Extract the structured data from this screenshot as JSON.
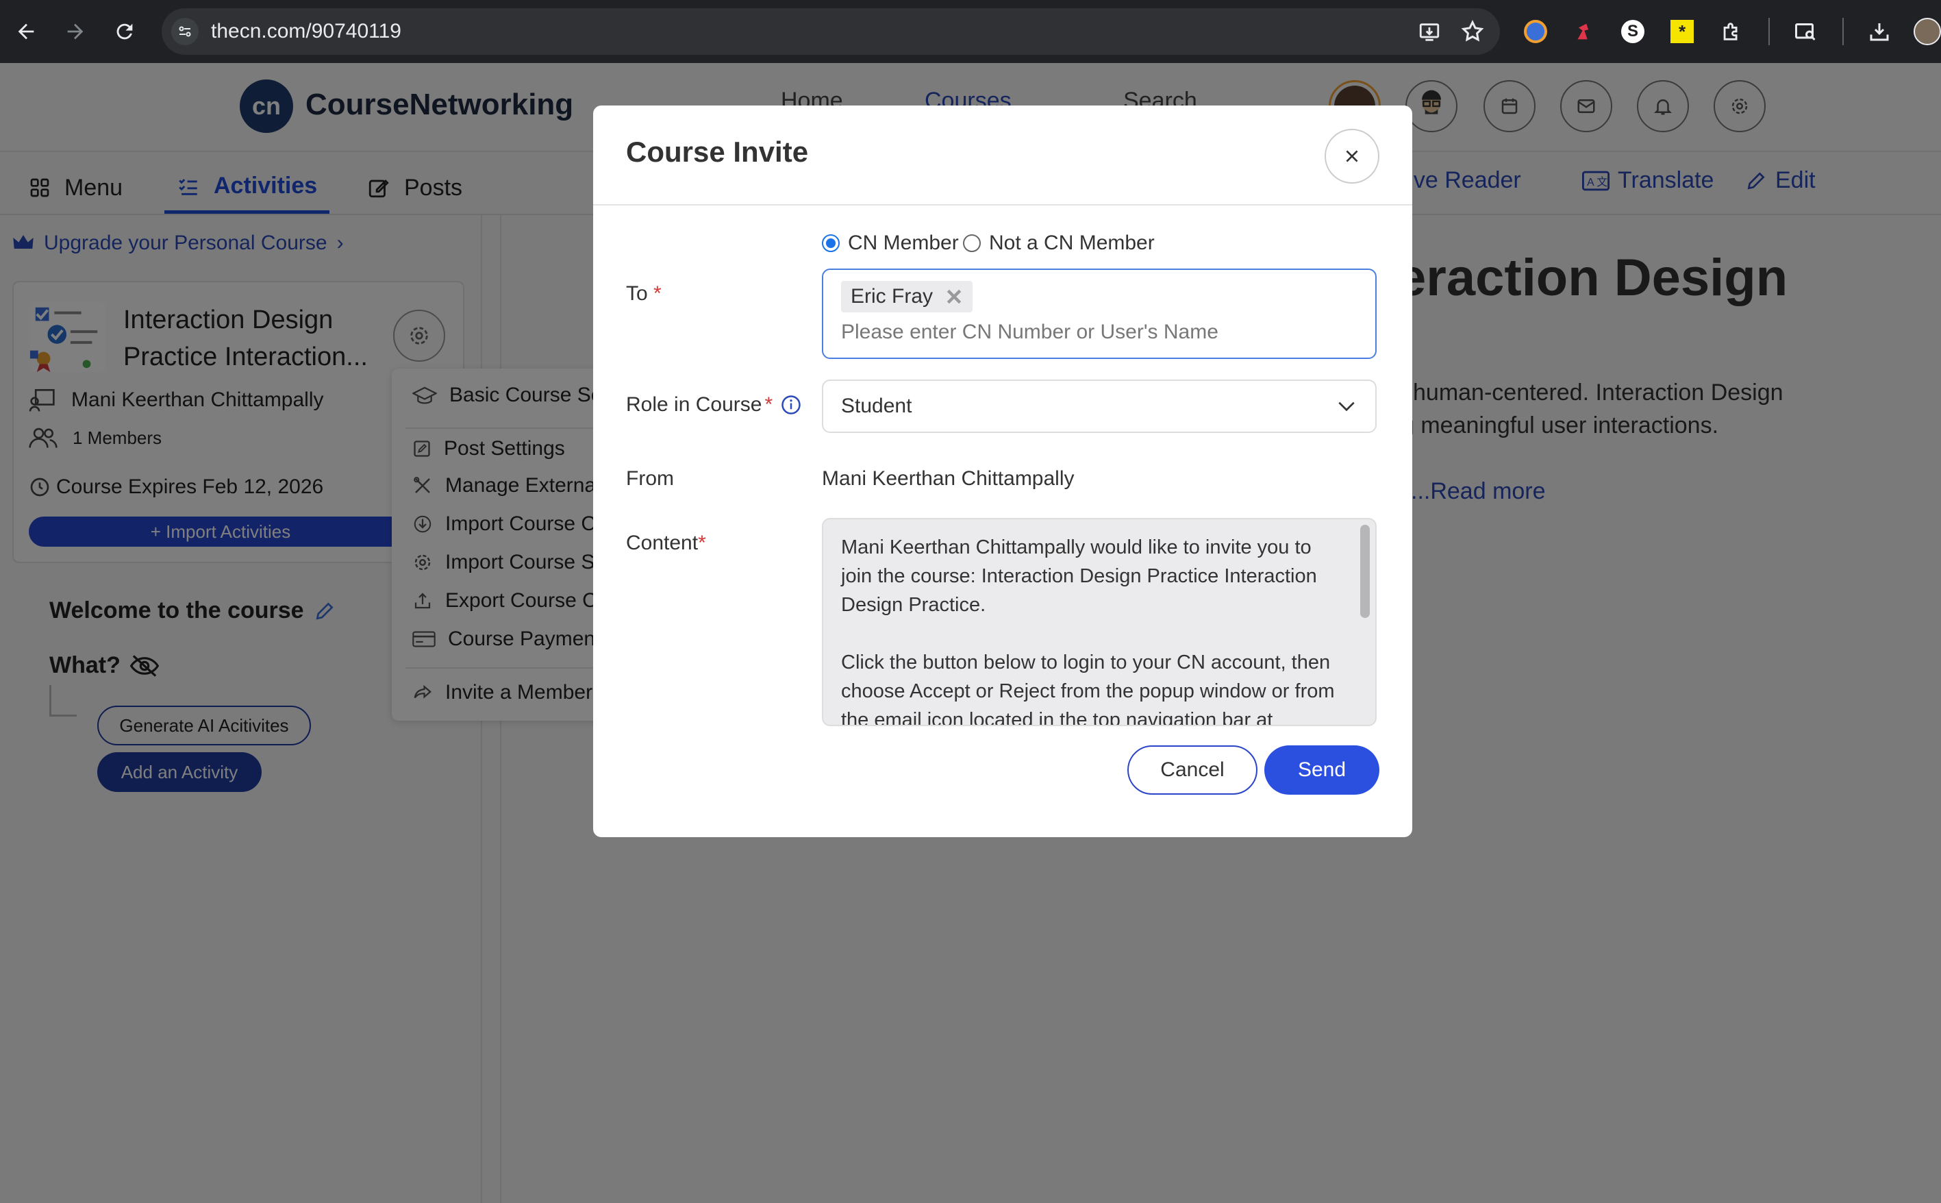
{
  "browser": {
    "url": "thecn.com/90740119",
    "icons": [
      "back-icon",
      "forward-icon",
      "reload-icon",
      "site-info-icon",
      "install-icon",
      "star-icon",
      "download-icon"
    ]
  },
  "header": {
    "logo_mark": "cn",
    "logo_text": "CourseNetworking",
    "nav": {
      "home": "Home",
      "courses": "Courses",
      "search": "Search"
    }
  },
  "tabs": {
    "menu": "Menu",
    "activities": "Activities",
    "posts": "Posts"
  },
  "tools": {
    "reader": "rsive Reader",
    "translate": "Translate",
    "edit": "Edit"
  },
  "sidebar": {
    "upgrade": "Upgrade your Personal Course",
    "course_title": "Interaction Design Practice Interaction...",
    "owner": "Mani Keerthan Chittampally",
    "members": "1 Members",
    "expires": "Course Expires Feb 12, 2026",
    "import_btn": "+ Import Activities",
    "welcome": "Welcome to the course",
    "what": "What?",
    "gen_ai": "Generate AI Acitivites",
    "add_activity": "Add an Activity"
  },
  "gear_menu": {
    "items": [
      "Basic Course Se",
      "Post Settings",
      "Manage External",
      "Import Course C",
      "Import Course S",
      "Export Course Co",
      "Course Payment",
      "Invite a Member"
    ]
  },
  "main": {
    "title_fragment": "eraction Design",
    "p1": "l human-centered. Interaction Design",
    "p2": "g meaningful user interactions.",
    "read_more": "...Read more"
  },
  "modal": {
    "title": "Course Invite",
    "radio_member": "CN Member",
    "radio_not_member": "Not a CN Member",
    "to_label": "To",
    "required_mark": "*",
    "chip": "Eric Fray",
    "to_placeholder": "Please enter CN Number or User's Name",
    "role_label": "Role in Course",
    "role_value": "Student",
    "from_label": "From",
    "from_value": "Mani Keerthan Chittampally",
    "content_label": "Content",
    "content_text": "Mani Keerthan Chittampally would like to invite you to join the course: Interaction Design Practice Interaction Design Practice.\n\nClick the button below to login to your CN account, then choose Accept or Reject from the popup window or from the email icon located in the top navigation bar at",
    "cancel": "Cancel",
    "send": "Send"
  },
  "colors": {
    "brand_blue": "#2b50e0",
    "tab_active": "#1f4bd8",
    "required_red": "#d43a3a",
    "chrome_bg": "#202124"
  }
}
